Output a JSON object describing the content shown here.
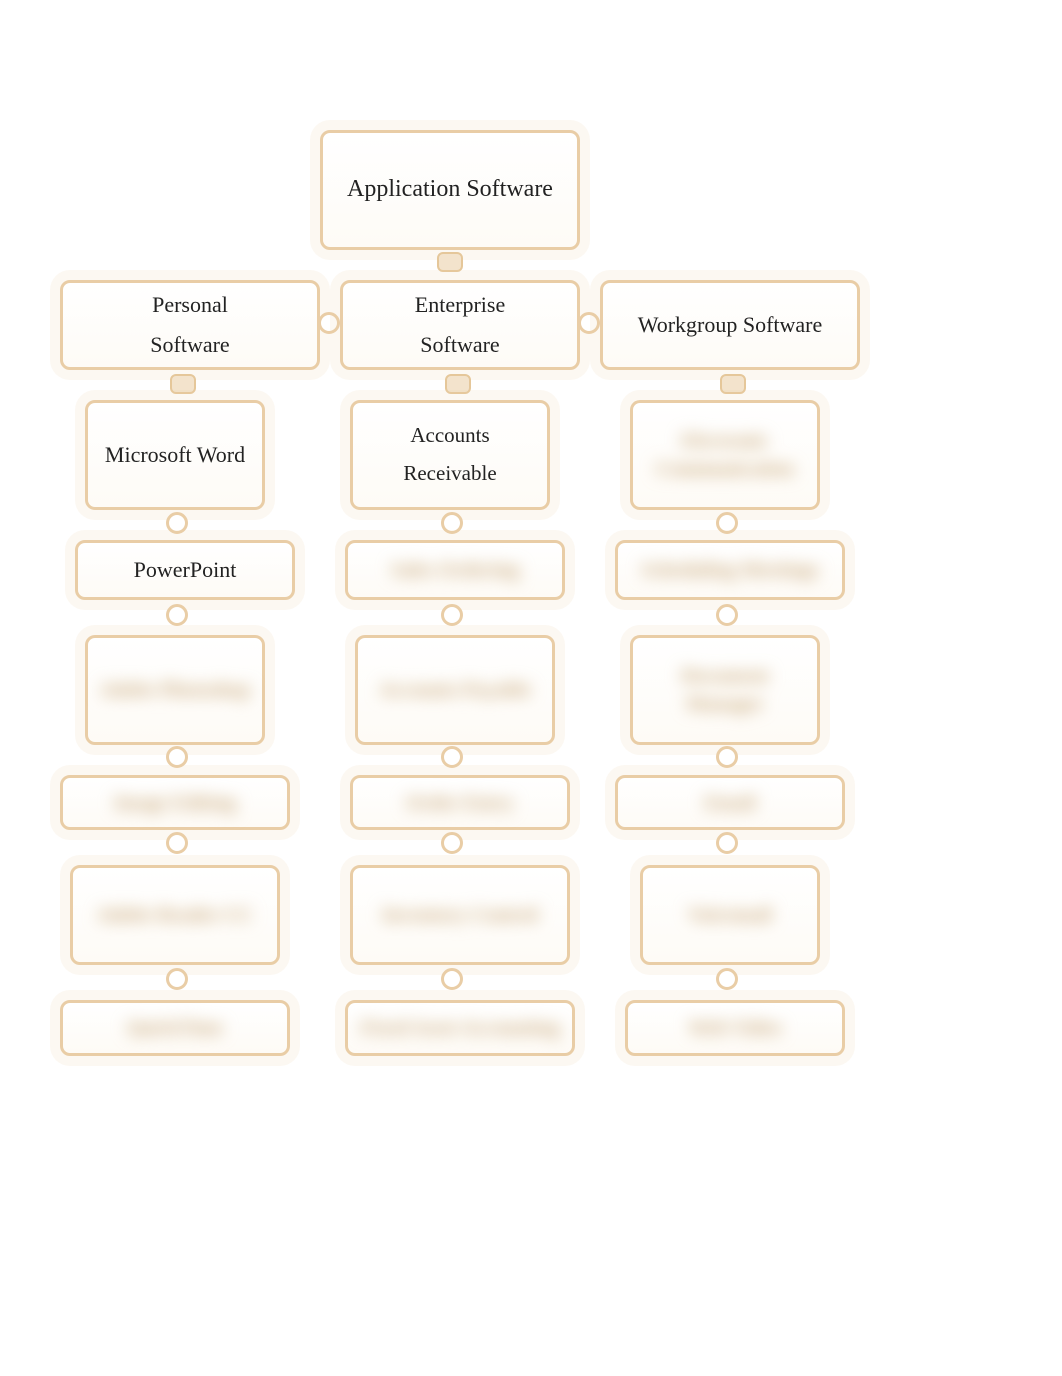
{
  "diagram": {
    "root": "Application Software",
    "categories": [
      {
        "title": "Personal\nSoftware",
        "items": [
          "Microsoft Word",
          "PowerPoint",
          "Adobe Photoshop",
          "Image Editing",
          "Adobe Reader CC",
          "QuickTime"
        ]
      },
      {
        "title": "Enterprise\nSoftware",
        "items": [
          "Accounts Receivable",
          "Sales Ordering",
          "Accounts Payable",
          "Order Entry",
          "Inventory Control",
          "Fixed Asset Accounting"
        ]
      },
      {
        "title": "Workgroup Software",
        "items": [
          "Electronic Communication",
          "Scheduling Meetings",
          "Document Manager",
          "Email",
          "Voicemail",
          "Web Video"
        ]
      }
    ]
  },
  "blurred": {
    "col1": [
      false,
      false,
      true,
      true,
      true,
      true
    ],
    "col2": [
      false,
      true,
      true,
      true,
      true,
      true
    ],
    "col3": [
      true,
      true,
      true,
      true,
      true,
      true
    ]
  },
  "colors": {
    "accent": "#e9cda6"
  }
}
